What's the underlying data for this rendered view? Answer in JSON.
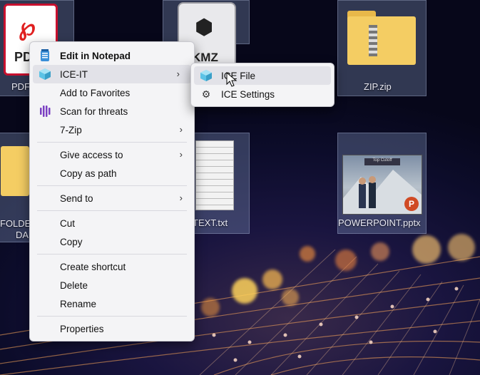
{
  "desktop": {
    "icons": {
      "pdf": {
        "label": "PDF",
        "badge": "PDF"
      },
      "kmz": {
        "badge": "KMZ"
      },
      "zip": {
        "label": "ZIP.zip"
      },
      "folder": {
        "label_line1": "FOLDER",
        "label_line2": "DA"
      },
      "text": {
        "label": "TEXT.txt"
      },
      "ppt": {
        "label": "POWERPOINT.pptx",
        "slide_title": "Top Cutoff"
      }
    }
  },
  "context_menu": {
    "items": [
      {
        "label": "Edit in Notepad",
        "icon": "notepad-icon"
      },
      {
        "label": "ICE-IT",
        "icon": "ice-cube-icon"
      },
      {
        "label": "Add to Favorites"
      },
      {
        "label": "Scan for threats",
        "icon": "scan-icon"
      },
      {
        "label": "7-Zip"
      },
      {
        "label": "Give access to"
      },
      {
        "label": "Copy as path"
      },
      {
        "label": "Send to"
      },
      {
        "label": "Cut"
      },
      {
        "label": "Copy"
      },
      {
        "label": "Create shortcut"
      },
      {
        "label": "Delete"
      },
      {
        "label": "Rename"
      },
      {
        "label": "Properties"
      }
    ]
  },
  "submenu": {
    "items": [
      {
        "label": "ICE File",
        "icon": "ice-cube-icon"
      },
      {
        "label": "ICE Settings",
        "icon": "gear-icon"
      }
    ]
  },
  "colors": {
    "menu_bg": "#f4f4f6",
    "highlight": "#e2e2e8",
    "ice_blue": "#4fb6d8",
    "scan_purple": "#7a3fc2"
  }
}
